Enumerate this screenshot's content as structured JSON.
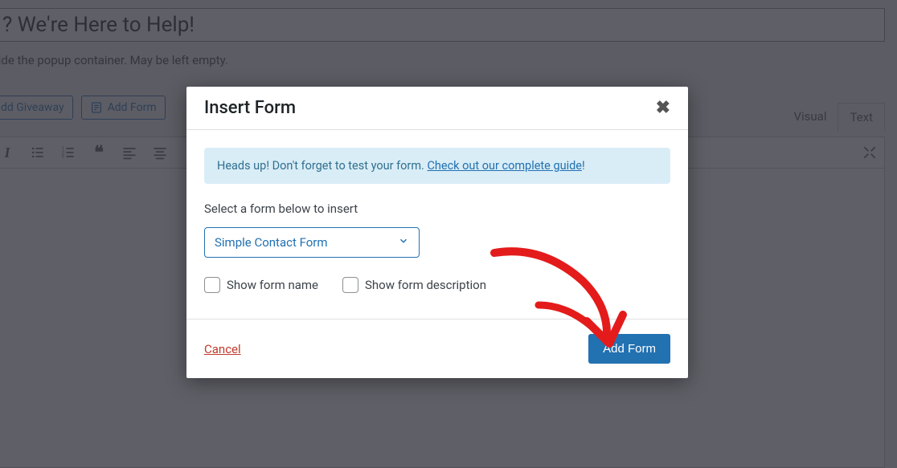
{
  "background": {
    "title_input": "? We're Here to Help!",
    "helper_text": "side the popup container. May be left empty.",
    "buttons": {
      "giveaway": "dd Giveaway",
      "add_form": "Add Form"
    },
    "tabs": {
      "visual": "Visual",
      "text": "Text"
    }
  },
  "modal": {
    "title": "Insert Form",
    "notice_prefix": "Heads up! Don't forget to test your form. ",
    "notice_link": "Check out our complete guide",
    "notice_suffix": "!",
    "select_label": "Select a form below to insert",
    "select_value": "Simple Contact Form",
    "show_name_label": "Show form name",
    "show_desc_label": "Show form description",
    "cancel": "Cancel",
    "submit": "Add Form"
  },
  "annotation": {
    "arrow_color": "#e41b1b"
  }
}
